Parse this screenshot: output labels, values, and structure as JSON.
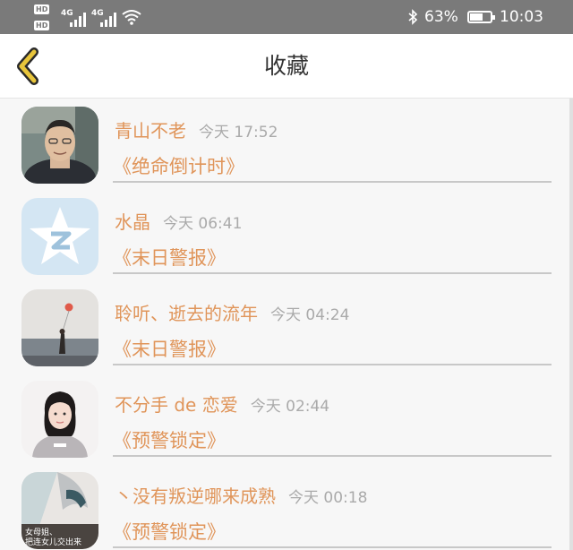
{
  "status_bar": {
    "network_1": "4G",
    "network_2": "4G",
    "battery_percent": "63%",
    "time": "10:03",
    "hd_label": "HD"
  },
  "header": {
    "title": "收藏",
    "back_icon": "chevron-left-icon",
    "accent_color": "#e8c53b"
  },
  "favorites": [
    {
      "name": "青山不老",
      "time": "今天 17:52",
      "work": "《绝命倒计时》"
    },
    {
      "name": "水晶",
      "time": "今天 06:41",
      "work": "《末日警报》"
    },
    {
      "name": "聆听、逝去的流年",
      "time": "今天 04:24",
      "work": "《末日警报》"
    },
    {
      "name": "不分手 de 恋爱",
      "time": "今天 02:44",
      "work": "《预警锁定》"
    },
    {
      "name": "丶没有叛逆哪来成熟",
      "time": "今天 00:18",
      "work": "《预警锁定》"
    }
  ],
  "colors": {
    "name_text": "#e0955a",
    "time_text": "#aaaaaa",
    "status_bar_bg": "#7a7a7a"
  },
  "avatar_5_overlay": [
    "女母姐、",
    "把连女儿交出来"
  ]
}
